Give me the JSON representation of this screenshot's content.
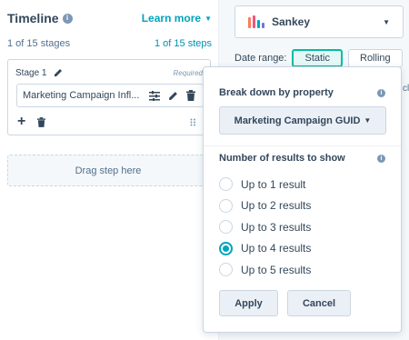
{
  "timeline": {
    "title": "Timeline",
    "learn_more": "Learn more",
    "stages_count": "1 of 15 stages",
    "steps_count": "1 of 15 steps",
    "stage_label": "Stage 1",
    "required": "Required",
    "step_text": "Marketing Campaign Infl...",
    "drag_text": "Drag step here"
  },
  "visualization": {
    "selected": "Sankey",
    "icon_colors": [
      "#ff7a59",
      "#00a4bd",
      "#f2547d",
      "#6a78d1"
    ]
  },
  "date_range": {
    "label": "Date range:",
    "options": [
      "Static",
      "Rolling"
    ],
    "active": "Static"
  },
  "popover": {
    "breakdown_title": "Break down by property",
    "property_value": "Marketing Campaign GUID",
    "results_title": "Number of results to show",
    "results_options": [
      "Up to 1 result",
      "Up to 2 results",
      "Up to 3 results",
      "Up to 4 results",
      "Up to 5 results"
    ],
    "selected_index": 3,
    "apply_label": "Apply",
    "cancel_label": "Cancel"
  },
  "edge_text": "clu",
  "colors": {
    "accent": "#00a4bd",
    "active_toggle": "#00bda5",
    "text": "#33475b"
  }
}
